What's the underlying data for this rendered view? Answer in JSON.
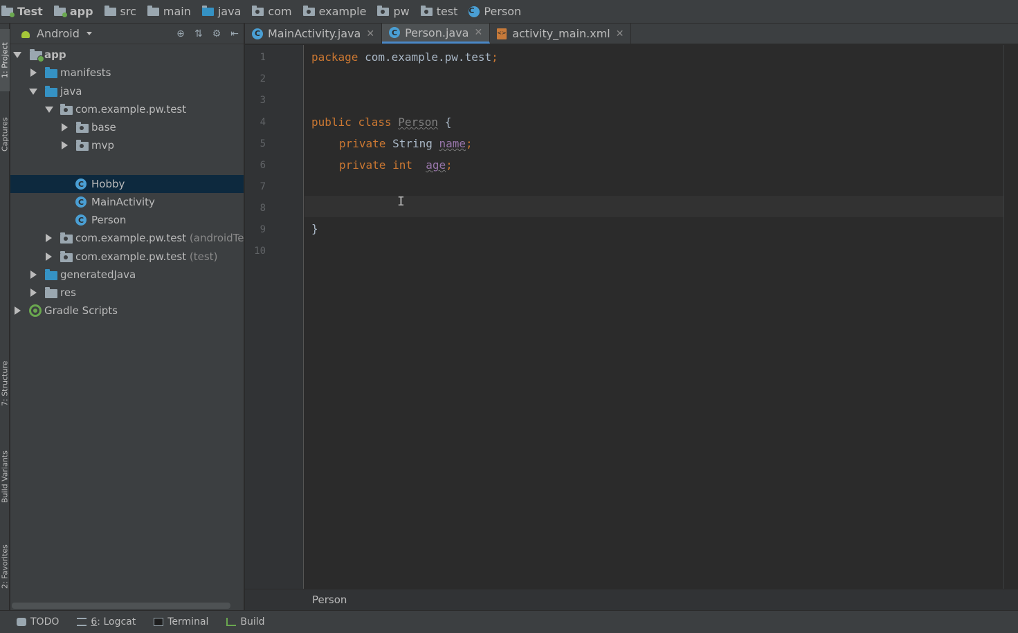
{
  "navbar": {
    "crumbs": [
      {
        "label": "Test",
        "icon": "folder-module-icon",
        "bold": true
      },
      {
        "label": "app",
        "icon": "folder-module-icon",
        "bold": true
      },
      {
        "label": "src",
        "icon": "folder-icon"
      },
      {
        "label": "main",
        "icon": "folder-icon"
      },
      {
        "label": "java",
        "icon": "folder-icon"
      },
      {
        "label": "com",
        "icon": "package-icon"
      },
      {
        "label": "example",
        "icon": "package-icon"
      },
      {
        "label": "pw",
        "icon": "package-icon"
      },
      {
        "label": "test",
        "icon": "package-icon"
      },
      {
        "label": "Person",
        "icon": "class-icon"
      }
    ],
    "class_icon_letter": "C"
  },
  "left_strip": {
    "project": "1: Project",
    "captures": "Captures",
    "structure": "7: Structure",
    "build_variants": "Build Variants",
    "favorites": "2: Favorites"
  },
  "project_panel": {
    "view_mode": "Android",
    "tree": {
      "app": "app",
      "manifests": "manifests",
      "java": "java",
      "pkg_main": "com.example.pw.test",
      "base": "base",
      "mvp": "mvp",
      "hobby": "Hobby",
      "main_activity": "MainActivity",
      "person": "Person",
      "pkg_android_test": "com.example.pw.test",
      "pkg_android_test_suffix": "(androidTest)",
      "pkg_test": "com.example.pw.test",
      "pkg_test_suffix": "(test)",
      "generated_java": "generatedJava",
      "res": "res",
      "gradle_scripts": "Gradle Scripts"
    },
    "selected_item": "Hobby"
  },
  "editor_tabs": [
    {
      "label": "MainActivity.java",
      "icon": "class-icon",
      "active": false
    },
    {
      "label": "Person.java",
      "icon": "class-icon",
      "active": true
    },
    {
      "label": "activity_main.xml",
      "icon": "xml-file-icon",
      "active": false
    }
  ],
  "editor": {
    "line_numbers": [
      "1",
      "2",
      "3",
      "4",
      "5",
      "6",
      "7",
      "8",
      "9",
      "10"
    ],
    "lines": {
      "l1_kw": "package",
      "l1_rest": " com.example.pw.test",
      "l1_semi": ";",
      "l4_kw1": "public",
      "l4_kw2": "class",
      "l4_name": "Person",
      "l4_brace": "{",
      "l5_kw": "private",
      "l5_type": "String",
      "l5_field": "name",
      "l5_semi": ";",
      "l6_kw": "private",
      "l6_type": "int",
      "l6_field": "age",
      "l6_semi": ";",
      "l9_brace": "}"
    },
    "current_line": 8
  },
  "editor_breadcrumb": "Person",
  "bottom_bar": {
    "todo": "TODO",
    "logcat_num": "6",
    "logcat": ": Logcat",
    "terminal": "Terminal",
    "build": "Build"
  },
  "colors": {
    "background": "#2b2b2b",
    "panel": "#3c3f41",
    "keyword": "#cc7832",
    "field": "#9876aa",
    "text": "#a9b7c6",
    "selection": "#0d293e",
    "accent": "#4a88c7"
  }
}
